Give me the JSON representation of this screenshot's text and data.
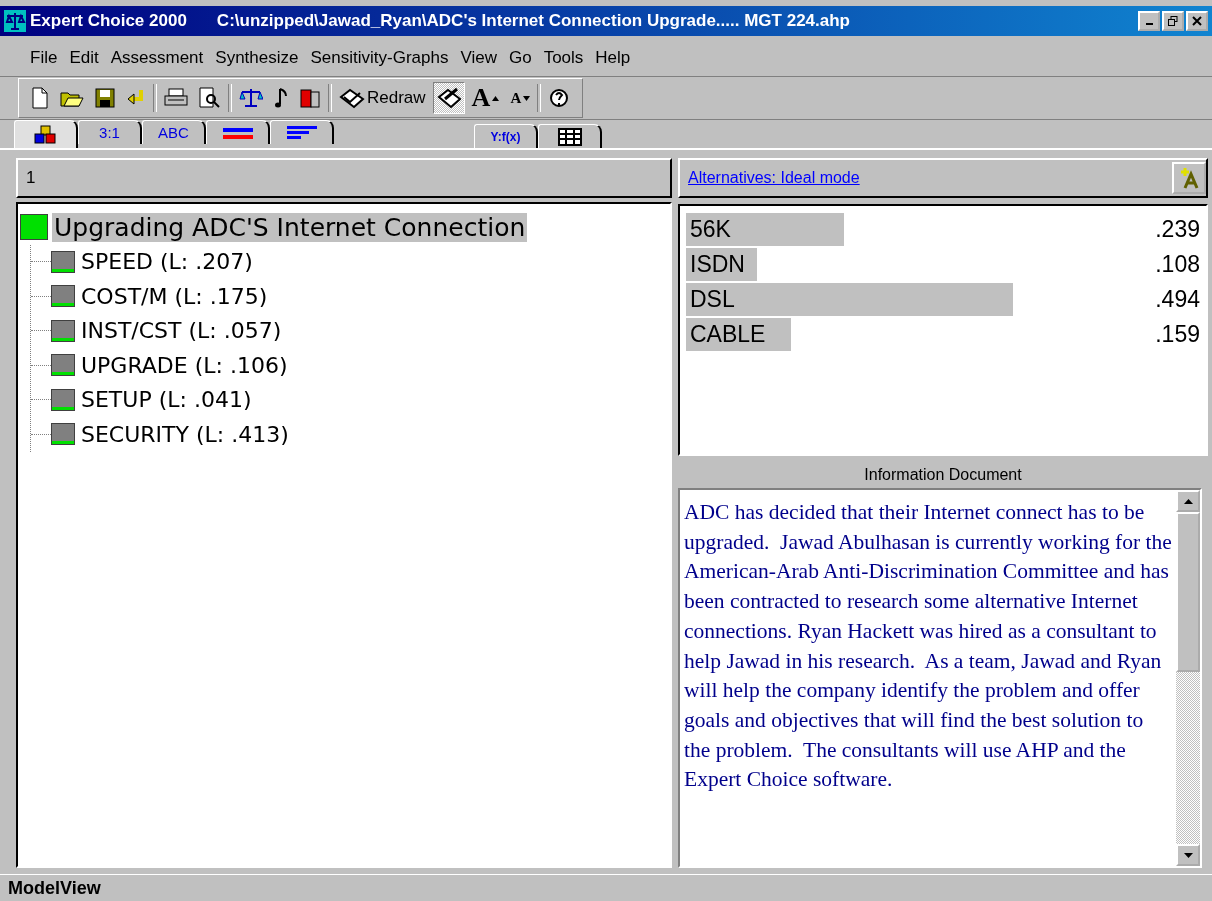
{
  "window": {
    "app": "Expert Choice 2000",
    "title": "C:\\unzipped\\Jawad_Ryan\\ADC's Internet Connection Upgrade..... MGT 224.ahp"
  },
  "menu": [
    "File",
    "Edit",
    "Assessment",
    "Synthesize",
    "Sensitivity-Graphs",
    "View",
    "Go",
    "Tools",
    "Help"
  ],
  "toolbar": [
    {
      "kind": "new",
      "pressed": false
    },
    {
      "kind": "open",
      "pressed": false
    },
    {
      "kind": "save",
      "pressed": false
    },
    {
      "kind": "undo",
      "pressed": false
    },
    {
      "kind": "sep"
    },
    {
      "kind": "print",
      "pressed": false
    },
    {
      "kind": "preview",
      "pressed": false
    },
    {
      "kind": "sep"
    },
    {
      "kind": "scales",
      "pressed": false
    },
    {
      "kind": "note",
      "pressed": false
    },
    {
      "kind": "book",
      "pressed": false
    },
    {
      "kind": "sep"
    },
    {
      "kind": "redraw",
      "label": "Redraw",
      "pressed": false
    },
    {
      "kind": "pencil",
      "pressed": true
    },
    {
      "kind": "font-up",
      "label": "A",
      "pressed": false
    },
    {
      "kind": "font-down",
      "label": "A",
      "pressed": false
    },
    {
      "kind": "sep"
    },
    {
      "kind": "help",
      "pressed": false
    }
  ],
  "tab_groups": [
    [
      {
        "kind": "cubes",
        "selected": true
      },
      {
        "kind": "text",
        "label": "3:1",
        "selected": false
      },
      {
        "kind": "text",
        "label": "ABC",
        "selected": false
      },
      {
        "kind": "bars",
        "selected": false
      },
      {
        "kind": "lines",
        "selected": false
      }
    ],
    [
      {
        "kind": "formula",
        "label": "Y:f(x)",
        "selected": false
      },
      {
        "kind": "grid",
        "selected": false
      }
    ]
  ],
  "left_panel": {
    "header": "1",
    "tree": {
      "label": "Upgrading ADC'S Internet Connection",
      "selected": true,
      "children": [
        {
          "label": "SPEED (L: .207)"
        },
        {
          "label": "COST/M (L: .175)"
        },
        {
          "label": "INST/CST (L: .057)"
        },
        {
          "label": "UPGRADE (L: .106)"
        },
        {
          "label": "SETUP (L: .041)"
        },
        {
          "label": "SECURITY (L: .413)"
        }
      ]
    }
  },
  "right_panel": {
    "link": "Alternatives: Ideal mode",
    "alternatives": [
      {
        "name": "56K",
        "value": ".239"
      },
      {
        "name": "ISDN",
        "value": ".108"
      },
      {
        "name": "DSL",
        "value": ".494"
      },
      {
        "name": "CABLE",
        "value": ".159"
      }
    ],
    "document_title": "Information Document",
    "document_text": "ADC has decided that their Internet connect has to be upgraded.  Jawad Abulhasan is currently working for the American-Arab Anti-Discrimination Committee and has been contracted to research some alternative Internet connections. Ryan Hackett was hired as a consultant to help Jawad in his research.  As a team, Jawad and Ryan will help the company identify the problem and offer goals and objectives that will find the best solution to the problem.  The consultants will use AHP and the Expert Choice software."
  },
  "status_bar": "ModelView"
}
